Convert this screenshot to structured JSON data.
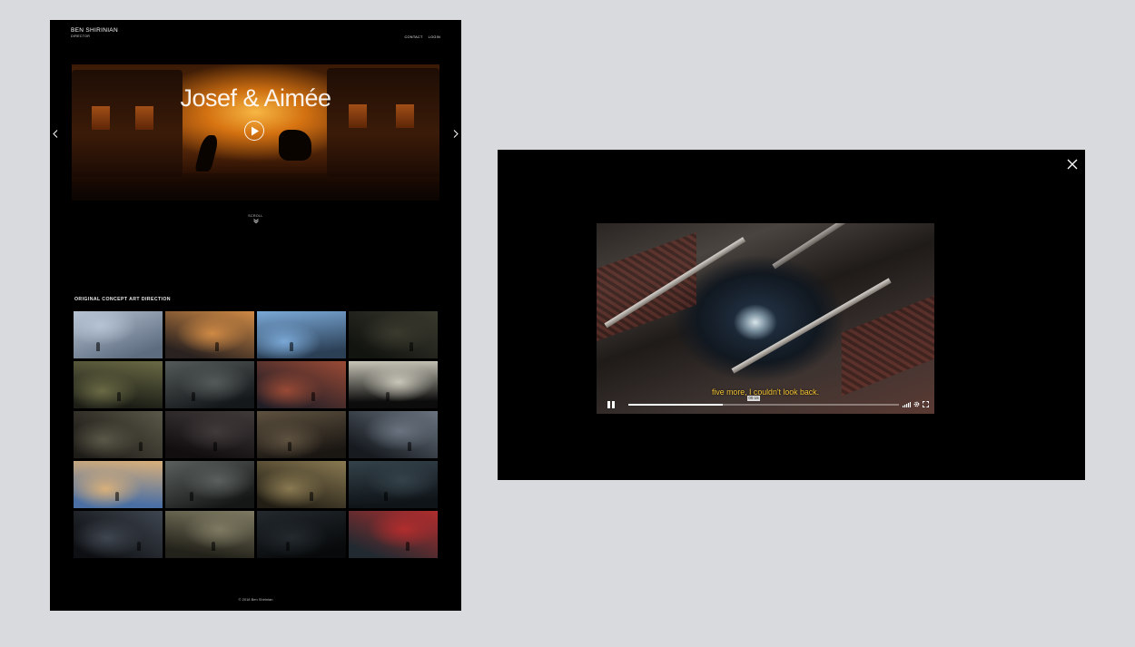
{
  "site": {
    "brand_name": "BEN SHIRINIAN",
    "brand_role": "DIRECTOR",
    "nav": {
      "contact": "CONTACT",
      "login": "LOGIN"
    },
    "hero": {
      "title": "Josef & Aimée"
    },
    "scroll_label": "SCROLL",
    "section_title": "ORIGINAL CONCEPT ART DIRECTION",
    "gallery": [
      {
        "icon": "ice-cave-scene",
        "colors": [
          "#b6c3d4",
          "#5d6c7f"
        ]
      },
      {
        "icon": "sunset-couple-scene",
        "colors": [
          "#d08a45",
          "#2a2220"
        ]
      },
      {
        "icon": "sky-explosion-scene",
        "colors": [
          "#7aa8d6",
          "#2b3f55"
        ]
      },
      {
        "icon": "train-passengers-scene",
        "colors": [
          "#3a3a2e",
          "#121410"
        ]
      },
      {
        "icon": "lamp-street-scene",
        "colors": [
          "#6a6a45",
          "#1b1d16"
        ]
      },
      {
        "icon": "rain-figure-scene",
        "colors": [
          "#545a5a",
          "#15181a"
        ]
      },
      {
        "icon": "fire-sky-scene",
        "colors": [
          "#9a4a35",
          "#1f1d26"
        ]
      },
      {
        "icon": "egg-hand-scene",
        "colors": [
          "#c8c6b8",
          "#0c0c0c"
        ]
      },
      {
        "icon": "stormy-field-scene",
        "colors": [
          "#5a5848",
          "#1e1c17"
        ]
      },
      {
        "icon": "red-coat-scene",
        "colors": [
          "#403a3a",
          "#120e10"
        ]
      },
      {
        "icon": "girl-portrait-scene",
        "colors": [
          "#5e5240",
          "#1a1612"
        ]
      },
      {
        "icon": "city-ruins-scene",
        "colors": [
          "#6a7480",
          "#171b20"
        ]
      },
      {
        "icon": "tent-blue-scene",
        "colors": [
          "#d9b07a",
          "#4a6fa4"
        ]
      },
      {
        "icon": "misty-forest-scene",
        "colors": [
          "#5b605e",
          "#151716"
        ]
      },
      {
        "icon": "bridge-river-scene",
        "colors": [
          "#8a7a52",
          "#221e15"
        ]
      },
      {
        "icon": "dark-woods-scene",
        "colors": [
          "#34424a",
          "#0f1418"
        ]
      },
      {
        "icon": "gothic-house-scene",
        "colors": [
          "#3f4650",
          "#0d0f12"
        ]
      },
      {
        "icon": "lone-tree-scene",
        "colors": [
          "#7e7a62",
          "#23221a"
        ]
      },
      {
        "icon": "night-rocks-scene",
        "colors": [
          "#23292e",
          "#07090a"
        ]
      },
      {
        "icon": "red-dress-woman-scene",
        "colors": [
          "#b22d2d",
          "#202a30"
        ]
      }
    ],
    "footer": "© 2018 Ben Shirinian"
  },
  "lightbox": {
    "subtitle": "five more, I couldn't look back.",
    "time_tooltip": "00:15",
    "progress": 0.35
  }
}
